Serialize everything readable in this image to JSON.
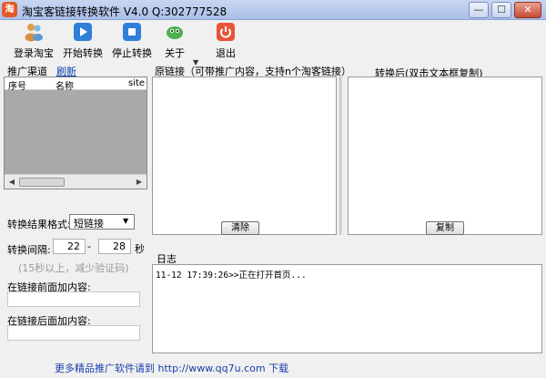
{
  "window": {
    "title": "淘宝客链接转换软件 V4.0   Q:302777528",
    "app_icon_glyph": "淘",
    "minimize_glyph": "—",
    "maximize_glyph": "☐",
    "close_glyph": "✕"
  },
  "toolbar": {
    "login_label": "登录淘宝",
    "start_label": "开始转换",
    "stop_label": "停止转换",
    "about_label": "关于",
    "exit_label": "退出",
    "dropdown_glyph": "▼"
  },
  "left": {
    "channel_label": "推广渠道",
    "refresh_link": "刷新",
    "columns": [
      "序号",
      "名称",
      "site"
    ],
    "scroll_left": "◀",
    "scroll_right": "▶",
    "format_label": "转换结果格式:",
    "format_value": "短链接",
    "interval_label": "转换间隔:",
    "interval_from": "22",
    "interval_dash": "-",
    "interval_to": "28",
    "seconds_label": "秒",
    "interval_hint": "(15秒以上，减少验证码)",
    "prefix_label": "在链接前面加内容:",
    "prefix_value": "",
    "suffix_label": "在链接后面加内容:",
    "suffix_value": ""
  },
  "right": {
    "original_label": "原链接（可带推广内容，支持n个淘客链接）",
    "converted_label": "转换后(双击文本框复制)",
    "clear_button": "清除",
    "copy_button": "复制",
    "log_label": "日志",
    "log_lines": [
      "11-12 17:39:26>>正在打开首页..."
    ]
  },
  "status": {
    "text": "更多精品推广软件请到 http://www.qq7u.com 下载"
  },
  "colors": {
    "titlebar": "#b4c7ee",
    "link": "#0645ad",
    "status_text": "#1a3ea8",
    "list_bg": "#a9a9a9"
  }
}
